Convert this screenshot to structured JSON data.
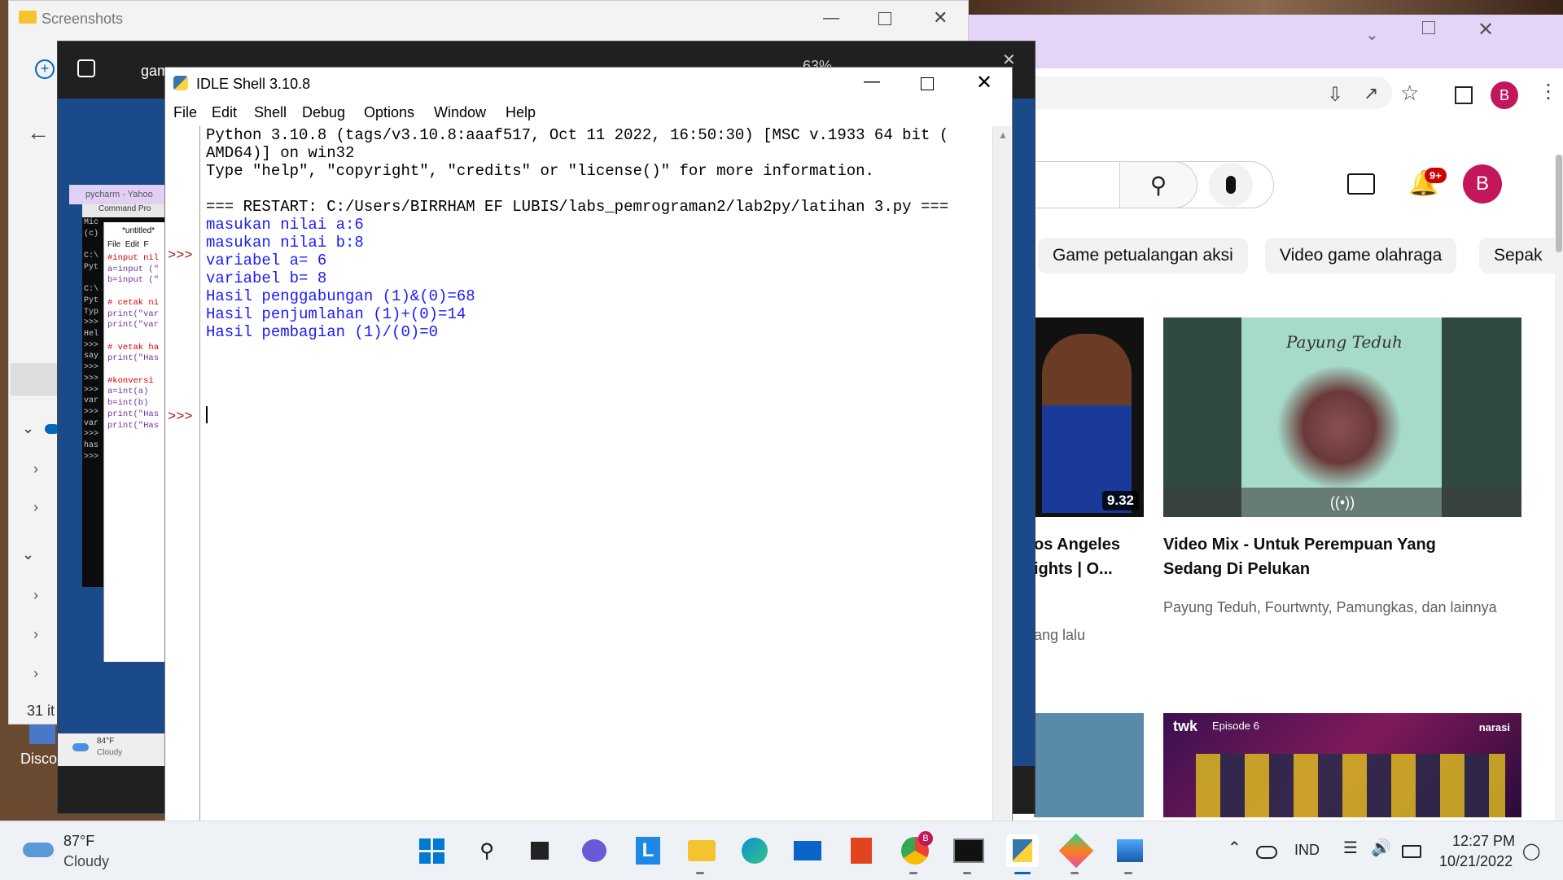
{
  "explorer": {
    "title": "Screenshots",
    "status": "31 it",
    "desktop_label": "Disco"
  },
  "photos": {
    "title": "gam",
    "zoom": "63%"
  },
  "weather_mini": {
    "temp": "84°F",
    "condition": "Cloudy"
  },
  "pycharm_tab": "pycharm - Yahoo",
  "cmd": {
    "title": "Command Pro",
    "lines": [
      "Mic",
      "(c)",
      "",
      "C:\\",
      "Pyt",
      "",
      "C:\\",
      "Pyt",
      "Typ",
      ">>>",
      "Hel",
      ">>>",
      "say",
      ">>>",
      ">>>",
      ">>>",
      "var",
      ">>>",
      "var",
      ">>>",
      "has",
      ">>>"
    ]
  },
  "notepad_untitled": {
    "title": "*untitled*",
    "menu": [
      "File",
      "Edit",
      "F"
    ],
    "lines": [
      "#input nil",
      "a=input (\"",
      "b=input (\"",
      "",
      "# cetak ni",
      "print(\"var",
      "print(\"var",
      "",
      "# vetak ha",
      "print(\"Has",
      "",
      "#konversi",
      "a=int(a)",
      "b=int(b)",
      "print(\"Has",
      "print(\"Has"
    ]
  },
  "idle": {
    "title": "IDLE Shell 3.10.8",
    "menu": [
      "File",
      "Edit",
      "Shell",
      "Debug",
      "Options",
      "Window",
      "Help"
    ],
    "prompt": ">>>",
    "lines": [
      "Python 3.10.8 (tags/v3.10.8:aaaf517, Oct 11 2022, 16:50:30) [MSC v.1933 64 bit (",
      "AMD64)] on win32",
      "Type \"help\", \"copyright\", \"credits\" or \"license()\" for more information.",
      "",
      "=== RESTART: C:/Users/BIRRHAM EF LUBIS/labs_pemrograman2/lab2py/latihan 3.py ===",
      "masukan nilai a:6",
      "masukan nilai b:8",
      "variabel a= 6",
      "variabel b= 8",
      "Hasil penggabungan (1)&(0)=68",
      "Hasil penjumlahan (1)+(0)=14",
      "Hasil pembagian (1)/(0)=0"
    ],
    "colors": {
      "output": "#1a1aff",
      "prompt": "#a31515",
      "text": "#000000"
    }
  },
  "youtube": {
    "avatar": "B",
    "notif_badge": "9+",
    "chips": [
      "Game petualangan aksi",
      "Video game olahraga",
      "Sepak"
    ],
    "video1": {
      "duration": "9.32",
      "title_lines": [
        "os Angeles",
        "ights | O..."
      ],
      "meta": "ang lalu"
    },
    "video2": {
      "title_lines": [
        "Video Mix - Untuk Perempuan Yang",
        "Sedang Di Pelukan"
      ],
      "channel": "Payung Teduh, Fourtwnty, Pamungkas, dan lainnya",
      "thumb_text": "Payung Teduh"
    },
    "video3": {
      "badge": "twk",
      "episode": "Episode 6",
      "brand": "narasi"
    }
  },
  "taskbar": {
    "weather_temp": "87°F",
    "weather_cond": "Cloudy",
    "lang": "IND",
    "time": "12:27 PM",
    "date": "10/21/2022",
    "chrome_badge": "B"
  }
}
